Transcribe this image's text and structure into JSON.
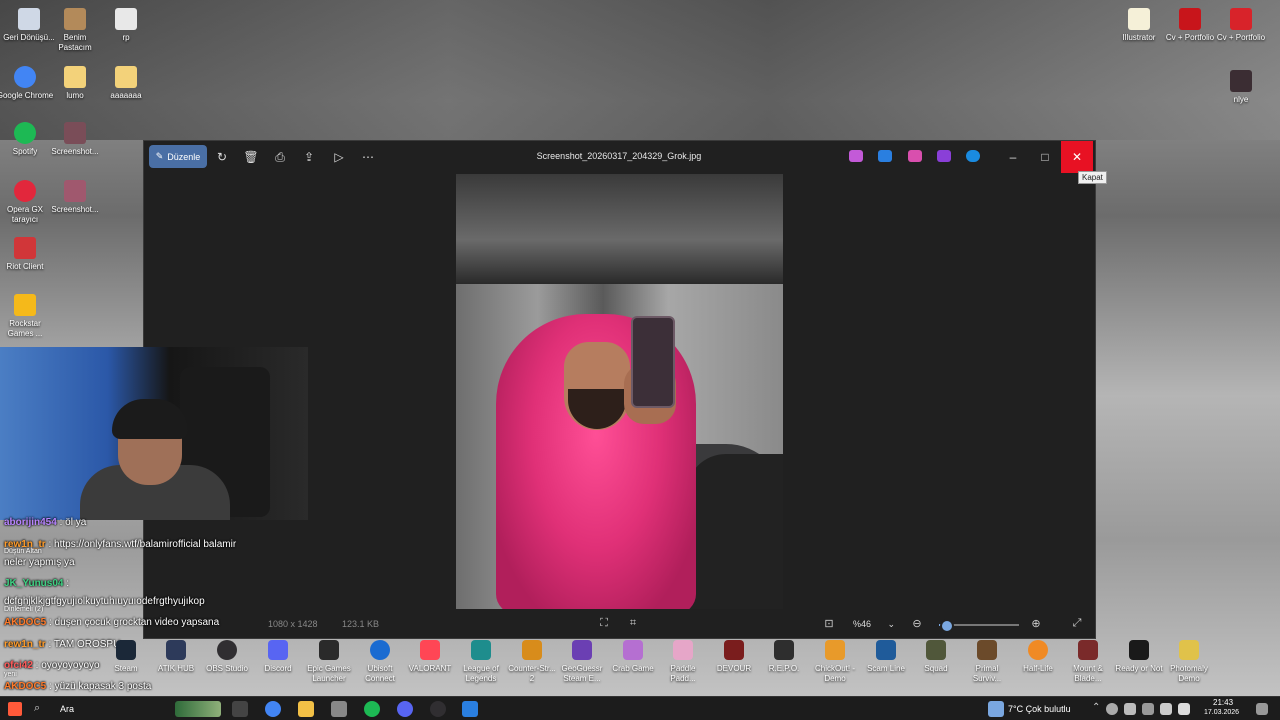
{
  "desktop_icons": [
    {
      "label": "Geri Dönüşü...",
      "color": "#cfd8e6"
    },
    {
      "label": "Benim Pastacım",
      "color": "#b38a5a"
    },
    {
      "label": "rp",
      "color": "#e8e8e8"
    },
    {
      "label": "Google Chrome",
      "color": "#4285f4"
    },
    {
      "label": "lumo",
      "color": "#f3d27a"
    },
    {
      "label": "aaaaaaa",
      "color": "#f3d27a"
    },
    {
      "label": "Spotify",
      "color": "#1db954"
    },
    {
      "label": "Screenshot...",
      "color": "#7a4d58"
    },
    {
      "label": "Opera GX tarayıcı",
      "color": "#e2273c"
    },
    {
      "label": "Screenshot...",
      "color": "#a0586e"
    },
    {
      "label": "Riot Client",
      "color": "#d13639"
    },
    {
      "label": "Rockstar Games ...",
      "color": "#f5b91a"
    },
    {
      "label": "Illustrator",
      "color": "#f5f0d8"
    },
    {
      "label": "Cv + Portfolio",
      "color": "#c8151b"
    },
    {
      "label": "Cv + Portfolio",
      "color": "#d8232a"
    },
    {
      "label": "nlye",
      "color": "#3b2d33"
    }
  ],
  "window": {
    "edit_label": "Düzenle",
    "title": "Screenshot_20260317_204329_Grok.jpg",
    "tooltip": "Kapat",
    "dimensions": "1080 x 1428",
    "file_size": "123.1 KB",
    "zoom": "%46",
    "zoom_level": 0.1
  },
  "chat": [
    {
      "user": "aborijin454",
      "user_color": "#b784ff",
      "message": "öl ya"
    },
    {
      "user": "rew1n_tr",
      "user_color": "#ff9c2a",
      "message": "https://onlyfans.wtf/balamirofficial balamir"
    },
    {
      "user": "",
      "user_color": "#ffffff",
      "message": "neler yapmış ya"
    },
    {
      "user": "JK_Yunus04",
      "user_color": "#3ed183",
      "message": ""
    },
    {
      "user": "",
      "user_color": "#ffffff",
      "message": "dcfghjklkjgtfgyujıolkuytuhıuyuıodefrgthyujıkop"
    },
    {
      "user": "AKDOC5",
      "user_color": "#ff7a2a",
      "message": "duşen çocuk grocktan video yapsana"
    },
    {
      "user": "rew1n_tr",
      "user_color": "#ff9c2a",
      "message": "TAM OROSPU"
    },
    {
      "user": "ofci42",
      "user_color": "#ff5a5a",
      "message": "oyoyoyoyoyo"
    },
    {
      "user": "AKDOC5",
      "user_color": "#ff7a2a",
      "message": "yüzü kapasak 3 posta"
    }
  ],
  "overlay_labels": [
    "Düşün Altan",
    "Dinlemeli (2)",
    "yeni"
  ],
  "apps": [
    {
      "label": "Steam",
      "color": "#1b2838"
    },
    {
      "label": "ATIK HUB",
      "color": "#2d3a5a"
    },
    {
      "label": "OBS Studio",
      "color": "#302e31"
    },
    {
      "label": "Discord",
      "color": "#5865f2"
    },
    {
      "label": "Epic Games Launcher",
      "color": "#2a2a2a"
    },
    {
      "label": "Ubisoft Connect",
      "color": "#1a6bd1"
    },
    {
      "label": "VALORANT",
      "color": "#ff4655"
    },
    {
      "label": "League of Legends",
      "color": "#1e8d8d"
    },
    {
      "label": "Counter-Str... 2",
      "color": "#d88c1b"
    },
    {
      "label": "GeoGuessr Steam E...",
      "color": "#6b3fb3"
    },
    {
      "label": "Crab Game",
      "color": "#b56fd1"
    },
    {
      "label": "Paddle Padd...",
      "color": "#e6a6c8"
    },
    {
      "label": "DEVOUR",
      "color": "#7a1d1d"
    },
    {
      "label": "R.E.P.O.",
      "color": "#2e2e2e"
    },
    {
      "label": "ChickOut! - Demo",
      "color": "#e89a2a"
    },
    {
      "label": "Scam Line",
      "color": "#1f5b9a"
    },
    {
      "label": "Squad",
      "color": "#50573a"
    },
    {
      "label": "Primal Surviv...",
      "color": "#6b4a2a"
    },
    {
      "label": "Half-Life",
      "color": "#f08a24"
    },
    {
      "label": "Mount & Blade...",
      "color": "#7a2a2a"
    },
    {
      "label": "Ready or Not",
      "color": "#1a1a1a"
    },
    {
      "label": "Photomaly Demo",
      "color": "#e0c24a"
    }
  ],
  "taskbar": {
    "search_placeholder": "Ara",
    "weather": "7°C  Çok bulutlu",
    "time": "21:43",
    "date": "17.03.2026"
  }
}
